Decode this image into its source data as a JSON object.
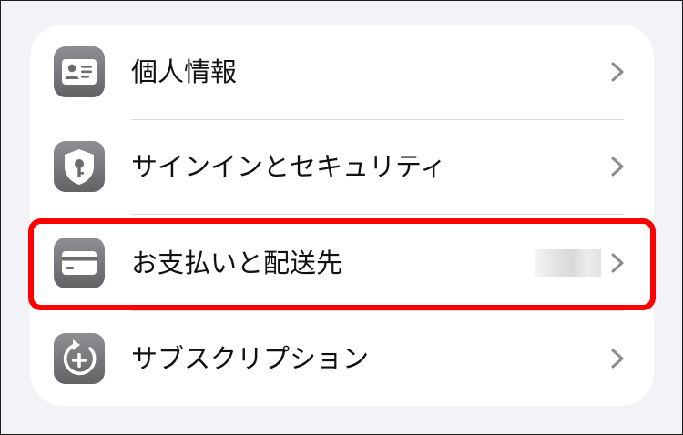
{
  "settings_list": {
    "items": [
      {
        "label": "個人情報",
        "icon": "person-card-icon"
      },
      {
        "label": "サインインとセキュリティ",
        "icon": "shield-key-icon"
      },
      {
        "label": "お支払いと配送先",
        "icon": "credit-card-icon"
      },
      {
        "label": "サブスクリプション",
        "icon": "subscription-plus-icon"
      }
    ]
  },
  "colors": {
    "background": "#f2f2f7",
    "card": "#ffffff",
    "icon_gray": "#7a7a80",
    "highlight": "#ff0000",
    "chevron": "#b8b8bd"
  }
}
